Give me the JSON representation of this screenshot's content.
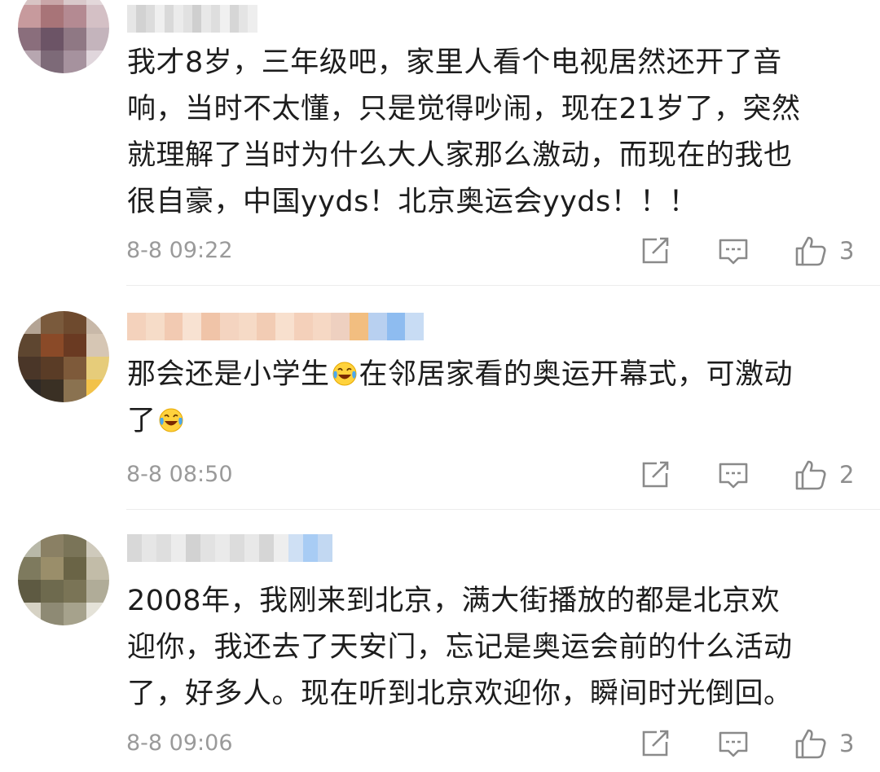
{
  "comments": [
    {
      "lines": [
        "我才8岁，三年级吧，家里人看个电视居然还开了音",
        "响，当时不太懂，只是觉得吵闹，现在21岁了，突然",
        "就理解了当时为什么大人家那么激动，而现在的我也",
        "很自豪，中国yyds！北京奥运会yyds！！！"
      ],
      "time": "8-8 09:22",
      "likes": "3",
      "avatar_colors": [
        "#d8c4c4",
        "#c9a6a8",
        "#d9c9cb",
        "#e3d8da",
        "#c79a9d",
        "#a87478",
        "#b48a92",
        "#d4c0c5",
        "#8a6e7c",
        "#6c5466",
        "#8f7884",
        "#c4b4bc",
        "#b7a6b0",
        "#7d6a78",
        "#a6929e",
        "#e0d6dc"
      ],
      "name_colors": [
        "#e6e6e6",
        "#d2d2d2",
        "#dcdcdc",
        "#efefef",
        "#d9d9d9",
        "#ebebeb",
        "#e1e1e1",
        "#cfcfcf",
        "#e8e8e8",
        "#dedede",
        "#f0f0f0",
        "#d6d6d6",
        "#e4e4e4",
        "#eeeeee"
      ]
    },
    {
      "line1_before_emoji": "那会还是小学生",
      "line1_after_emoji": "在邻居家看的奥运开幕式，可激动",
      "line2": "了",
      "time": "8-8 08:50",
      "likes": "2",
      "avatar_colors": [
        "#b4a494",
        "#7a5a3c",
        "#6e4a2e",
        "#c8b8a8",
        "#5e4630",
        "#8a4a28",
        "#6a3a22",
        "#d6c6b4",
        "#4a3628",
        "#5a3c26",
        "#7e5a3a",
        "#e6cc7a",
        "#2e2a26",
        "#3a3024",
        "#8a7250",
        "#f2c24a"
      ],
      "name_colors": [
        "#f4d2bc",
        "#f6dcc8",
        "#f2cab2",
        "#f8e2d2",
        "#f0c4a8",
        "#f4d4c0",
        "#f6dac6",
        "#f2ccb4",
        "#f8e0ce",
        "#f4d0ba",
        "#f6d8c4",
        "#eed0c0",
        "#f2be80",
        "#b8d0f0",
        "#8ebcf0",
        "#c8dcf4"
      ]
    },
    {
      "lines": [
        "2008年，我刚来到北京，满大街播放的都是北京欢",
        "迎你，我还去了天安门，忘记是奥运会前的什么活动",
        "了，好多人。现在听到北京欢迎你，瞬间时光倒回。"
      ],
      "time": "8-8 09:06",
      "likes": "3",
      "avatar_colors": [
        "#b8b8a8",
        "#8a8064",
        "#7a7458",
        "#cfcabc",
        "#7e7a5e",
        "#9a8e6a",
        "#6a6446",
        "#c2bca8",
        "#5e5a42",
        "#6e6a4e",
        "#7a7456",
        "#b0ac98",
        "#d6d2c4",
        "#8e8a74",
        "#a6a28c",
        "#e4e2d8"
      ],
      "name_colors": [
        "#d8d8d8",
        "#e6e6e6",
        "#dedede",
        "#ececec",
        "#d2d2d2",
        "#e2e2e2",
        "#eaeaea",
        "#dcdcdc",
        "#e8e8e8",
        "#d6d6d6",
        "#eeeeee",
        "#cfe0f4",
        "#a8ccf4",
        "#c2d8f2"
      ]
    }
  ]
}
